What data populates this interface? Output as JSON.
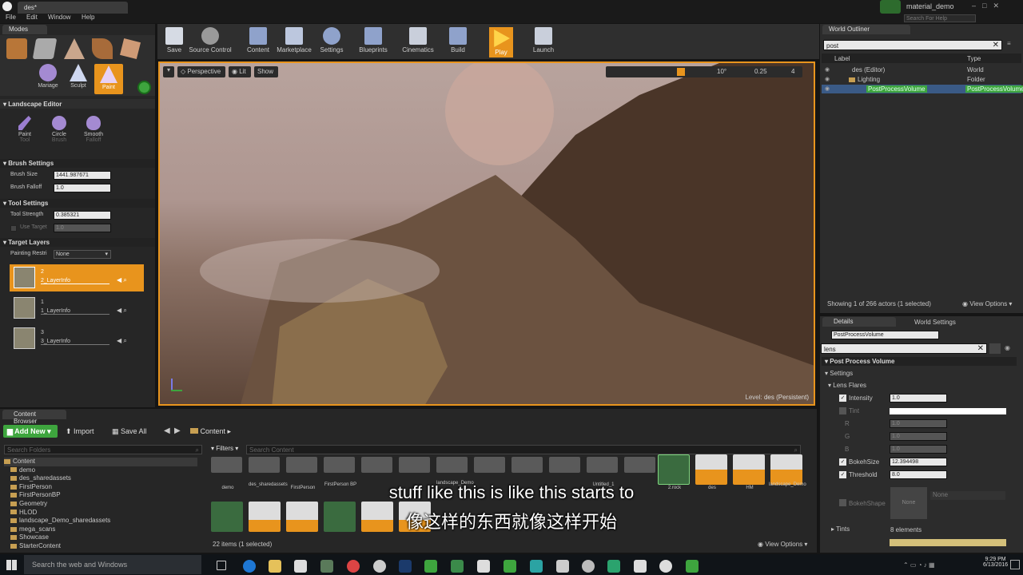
{
  "window": {
    "tab": "des*",
    "brand": "material_demo",
    "help_placeholder": "Search For Help"
  },
  "menu": [
    "File",
    "Edit",
    "Window",
    "Help"
  ],
  "modes": {
    "title": "Modes",
    "tools_row2": [
      "Mariage",
      "Sculpt",
      "Paint"
    ]
  },
  "landscape": {
    "title": "Landscape Editor",
    "brush_tools": [
      {
        "label": "Paint",
        "sub": "Tool"
      },
      {
        "label": "Circle",
        "sub": "Brush"
      },
      {
        "label": "Smooth",
        "sub": "Falloff"
      }
    ],
    "brush_settings": {
      "title": "Brush Settings",
      "size_label": "Brush Size",
      "size_value": "1441.987671",
      "falloff_label": "Brush Falloff",
      "falloff_value": "1.0"
    },
    "tool_settings": {
      "title": "Tool Settings",
      "strength_label": "Tool Strength",
      "strength_value": "0.385321",
      "target_label": "Use Target",
      "target_value": "1.0"
    },
    "target_layers": {
      "title": "Target Layers",
      "restrict_label": "Painting Restri",
      "restrict_value": "None",
      "layers": [
        {
          "num": "2",
          "name": "2_LayerInfo"
        },
        {
          "num": "1",
          "name": "1_LayerInfo"
        },
        {
          "num": "3",
          "name": "3_LayerInfo"
        }
      ]
    }
  },
  "toolbar": {
    "buttons": [
      "Save",
      "Source Control",
      "Content",
      "Marketplace",
      "Settings",
      "Blueprints",
      "Cinematics",
      "Build",
      "Play",
      "Launch"
    ]
  },
  "viewport": {
    "view_mode": "Perspective",
    "lit": "Lit",
    "show": "Show",
    "snap_angle": "10°",
    "snap_scale": "0.25",
    "cam_speed": "4",
    "level_label": "Level:",
    "level_name": "des (Persistent)"
  },
  "outliner": {
    "title": "World Outliner",
    "search": "post",
    "col_label": "Label",
    "col_type": "Type",
    "rows": [
      {
        "label": "des (Editor)",
        "type": "World"
      },
      {
        "label": "Lighting",
        "type": "Folder"
      },
      {
        "label": "PostProcessVolume",
        "type": "PostProcessVolume"
      }
    ],
    "status": "Showing 1 of 266 actors (1 selected)",
    "view_options": "View Options"
  },
  "details": {
    "tab1": "Details",
    "tab2": "World Settings",
    "actor_name": "PostProcessVolume",
    "search": "lens",
    "section": "Post Process Volume",
    "settings": "Settings",
    "lens_flares": "Lens Flares",
    "intensity_label": "Intensity",
    "intensity_value": "1.0",
    "tint_label": "Tint",
    "r": "R",
    "g": "G",
    "b": "B",
    "rgb_value": "1.0",
    "bokeh_size_label": "BokehSize",
    "bokeh_size_value": "12.394498",
    "threshold_label": "Threshold",
    "threshold_value": "8.0",
    "bokeh_shape_label": "BokehShape",
    "bokeh_shape_thumb": "None",
    "bokeh_shape_value": "None",
    "tints_label": "Tints",
    "tints_value": "8 elements"
  },
  "content_browser": {
    "tab": "Content Browser",
    "add_new": "Add New",
    "import": "Import",
    "save_all": "Save All",
    "path": "Content",
    "search_folders": "Search Folders",
    "filters": "Filters",
    "search_content": "Search Content",
    "tree": [
      "Content",
      "demo",
      "des_sharedassets",
      "FirstPerson",
      "FirstPersonBP",
      "Geometry",
      "HLOD",
      "landscape_Demo_sharedassets",
      "mega_scans",
      "Showcase",
      "StarterContent"
    ],
    "folders": [
      "demo",
      "des_sharedassets",
      "FirstPerson",
      "FirstPerson BP",
      "",
      "",
      "landscape_Demo",
      "",
      "",
      "Untitled_1",
      ""
    ],
    "named_assets": [
      "2.rock",
      "des",
      "HM",
      "landscape_Demo"
    ],
    "status": "22 items (1 selected)",
    "view_options": "View Options"
  },
  "subtitles": {
    "en": "stuff like this is like this starts to",
    "zh": "像这样的东西就像这样开始"
  },
  "taskbar": {
    "search": "Search the web and Windows",
    "time": "9:29 PM",
    "date": "6/13/2016"
  },
  "colors": {
    "accent_orange": "#f39c12",
    "selected_orange": "#e8941d",
    "green": "#3ea53e"
  }
}
